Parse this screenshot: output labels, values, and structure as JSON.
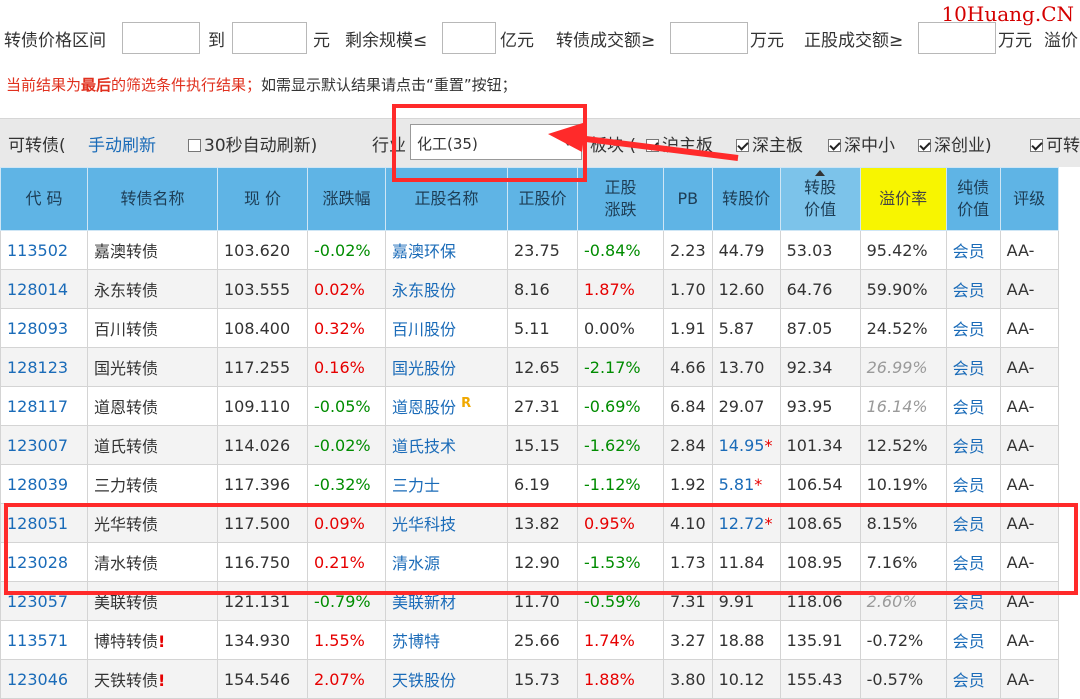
{
  "filters": {
    "price_range_label": "转债价格区间",
    "to_label": "到",
    "yuan_label": "元",
    "remaining_label": "剩余规模≤",
    "yi_unit": "亿元",
    "bond_volume_label": "转债成交额≥",
    "wan_unit_1": "万元",
    "stock_volume_label": "正股成交额≥",
    "wan_unit_2": "万元",
    "premium_label": "溢价",
    "price_min": "",
    "price_max": "",
    "remaining_max": "",
    "bond_volume_min": "",
    "stock_volume_min": ""
  },
  "brand": "10Huang.CN",
  "notice": {
    "prefix": "当前结果为",
    "bold": "最后",
    "middle": "的筛选条件执行结果；",
    "suffix": "如需显示默认结果请点击“重置”按钮；"
  },
  "toolbar": {
    "convertible_label": "可转债(",
    "manual_refresh": "手动刷新",
    "auto_refresh_label": "30秒自动刷新)",
    "industry_label": "行业",
    "industry_value": "化工(35)",
    "board_label": "板块 (",
    "boards": [
      "沪主板",
      "深主板",
      "深中小",
      "深创业)"
    ],
    "tradable_label": "可转"
  },
  "table": {
    "headers": [
      "代 码",
      "转债名称",
      "现 价",
      "涨跌幅",
      "正股名称",
      "正股价",
      "正股\n涨跌",
      "PB",
      "转股价",
      "转股\n价值",
      "溢价率",
      "纯债\n价值",
      "评级"
    ],
    "rows": [
      {
        "code": "113502",
        "name": "嘉澳转债",
        "price": "103.620",
        "chg": "-0.02%",
        "stock": "嘉澳环保",
        "sprice": "23.75",
        "schg": "-0.84%",
        "pb": "2.23",
        "conv": "44.79",
        "cvalue": "53.03",
        "premium": "95.42%",
        "bond": "会员",
        "rating": "AA-"
      },
      {
        "code": "128014",
        "name": "永东转债",
        "price": "103.555",
        "chg": "0.02%",
        "stock": "永东股份",
        "sprice": "8.16",
        "schg": "1.87%",
        "pb": "1.70",
        "conv": "12.60",
        "cvalue": "64.76",
        "premium": "59.90%",
        "bond": "会员",
        "rating": "AA-"
      },
      {
        "code": "128093",
        "name": "百川转债",
        "price": "108.400",
        "chg": "0.32%",
        "stock": "百川股份",
        "sprice": "5.11",
        "schg": "0.00%",
        "pb": "1.91",
        "conv": "5.87",
        "cvalue": "87.05",
        "premium": "24.52%",
        "bond": "会员",
        "rating": "AA-"
      },
      {
        "code": "128123",
        "name": "国光转债",
        "price": "117.255",
        "chg": "0.16%",
        "stock": "国光股份",
        "sprice": "12.65",
        "schg": "-2.17%",
        "pb": "4.66",
        "conv": "13.70",
        "cvalue": "92.34",
        "premium": "26.99%",
        "bond": "会员",
        "rating": "AA-"
      },
      {
        "code": "128117",
        "name": "道恩转债",
        "price": "109.110",
        "chg": "-0.05%",
        "stock": "道恩股份",
        "badge": "R",
        "sprice": "27.31",
        "schg": "-0.69%",
        "pb": "6.84",
        "conv": "29.07",
        "cvalue": "93.95",
        "premium": "16.14%",
        "bond": "会员",
        "rating": "AA-"
      },
      {
        "code": "123007",
        "name": "道氏转债",
        "price": "114.026",
        "chg": "-0.02%",
        "stock": "道氏技术",
        "sprice": "15.15",
        "schg": "-1.62%",
        "pb": "2.84",
        "conv": "14.95",
        "conv_star": "*",
        "cvalue": "101.34",
        "premium": "12.52%",
        "bond": "会员",
        "rating": "AA-"
      },
      {
        "code": "128039",
        "name": "三力转债",
        "price": "117.396",
        "chg": "-0.32%",
        "stock": "三力士",
        "sprice": "6.19",
        "schg": "-1.12%",
        "pb": "1.92",
        "conv": "5.81",
        "conv_star": "*",
        "cvalue": "106.54",
        "premium": "10.19%",
        "bond": "会员",
        "rating": "AA-"
      },
      {
        "code": "128051",
        "name": "光华转债",
        "price": "117.500",
        "chg": "0.09%",
        "stock": "光华科技",
        "sprice": "13.82",
        "schg": "0.95%",
        "pb": "4.10",
        "conv": "12.72",
        "conv_star": "*",
        "cvalue": "108.65",
        "premium": "8.15%",
        "bond": "会员",
        "rating": "AA-"
      },
      {
        "code": "123028",
        "name": "清水转债",
        "price": "116.750",
        "chg": "0.21%",
        "stock": "清水源",
        "sprice": "12.90",
        "schg": "-1.53%",
        "pb": "1.73",
        "conv": "11.84",
        "cvalue": "108.95",
        "premium": "7.16%",
        "bond": "会员",
        "rating": "AA-"
      },
      {
        "code": "123057",
        "name": "美联转债",
        "price": "121.131",
        "chg": "-0.79%",
        "stock": "美联新材",
        "sprice": "11.70",
        "schg": "-0.59%",
        "pb": "7.31",
        "conv": "9.91",
        "cvalue": "118.06",
        "premium": "2.60%",
        "bond": "会员",
        "rating": "AA-"
      },
      {
        "code": "113571",
        "name": "博特转债",
        "warn": "!",
        "price": "134.930",
        "chg": "1.55%",
        "stock": "苏博特",
        "sprice": "25.66",
        "schg": "1.74%",
        "pb": "3.27",
        "conv": "18.88",
        "cvalue": "135.91",
        "premium": "-0.72%",
        "bond": "会员",
        "rating": "AA-"
      },
      {
        "code": "123046",
        "name": "天铁转债",
        "warn": "!",
        "price": "154.546",
        "chg": "2.07%",
        "stock": "天铁股份",
        "sprice": "15.73",
        "schg": "1.88%",
        "pb": "3.80",
        "conv": "10.12",
        "cvalue": "155.43",
        "premium": "-0.57%",
        "bond": "会员",
        "rating": "AA-"
      }
    ]
  },
  "colors": {
    "header_bg": "#5fb4e5",
    "premium_header": "#f8f500",
    "up": "#e60000",
    "down": "#008c00",
    "link": "#1a6bb8",
    "annotation": "#ff2a2a"
  }
}
